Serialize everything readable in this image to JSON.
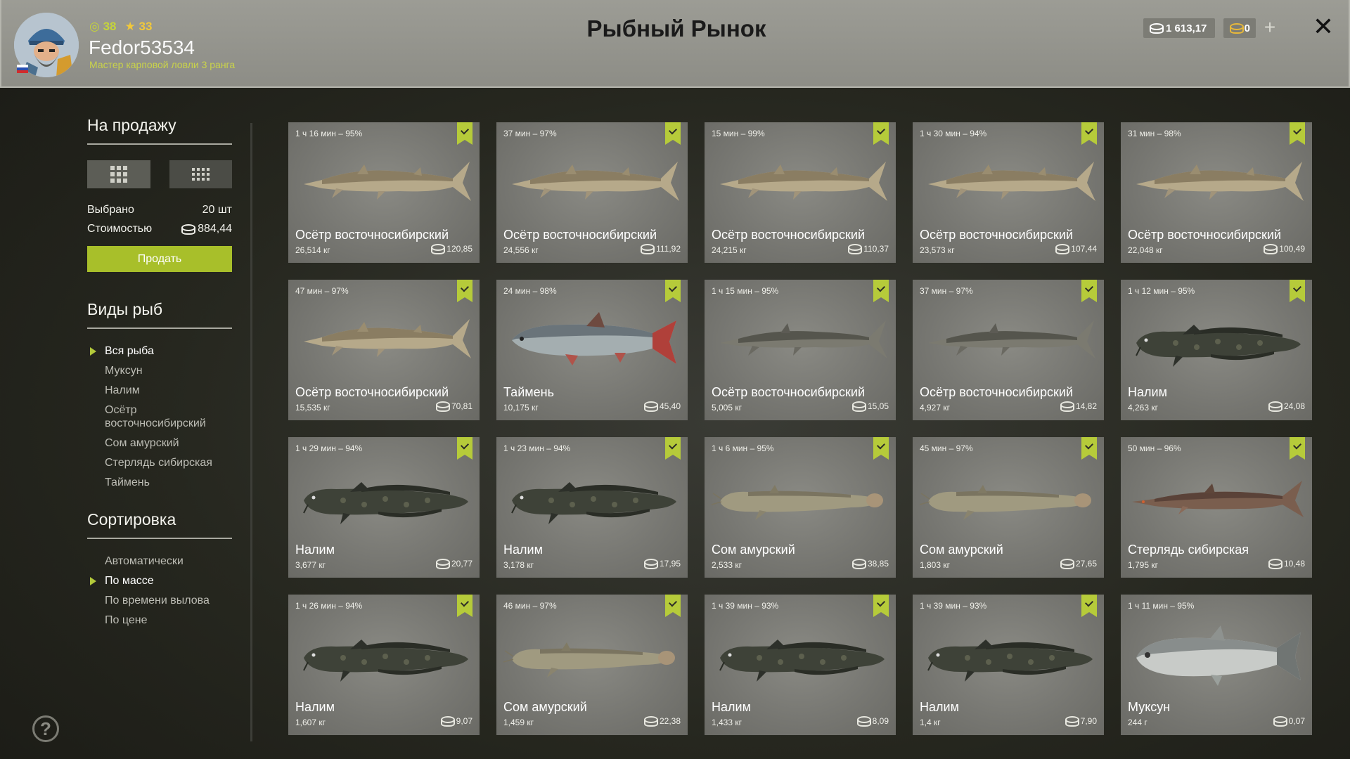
{
  "header": {
    "title": "Рыбный Рынок",
    "level": "38",
    "rank": "33",
    "username": "Fedor53534",
    "subtitle": "Мастер карповой ловли 3 ранга",
    "silver": "1 613,17",
    "gold": "0",
    "plus": "+",
    "close": "✕"
  },
  "sidebar": {
    "for_sale_title": "На продажу",
    "selected_label": "Выбрано",
    "selected_value": "20 шт",
    "cost_label": "Стоимостью",
    "cost_value": "884,44",
    "sell_button": "Продать",
    "species_title": "Виды рыб",
    "species": [
      {
        "label": "Вся рыба",
        "active": true
      },
      {
        "label": "Муксун",
        "active": false
      },
      {
        "label": "Налим",
        "active": false
      },
      {
        "label": "Осётр восточносибирский",
        "active": false
      },
      {
        "label": "Сом амурский",
        "active": false
      },
      {
        "label": "Стерлядь сибирская",
        "active": false
      },
      {
        "label": "Таймень",
        "active": false
      }
    ],
    "sort_title": "Сортировка",
    "sort": [
      {
        "label": "Автоматически",
        "active": false
      },
      {
        "label": "По массе",
        "active": true
      },
      {
        "label": "По времени вылова",
        "active": false
      },
      {
        "label": "По цене",
        "active": false
      }
    ],
    "help": "?"
  },
  "fish": [
    {
      "time": "1 ч 16 мин – 95%",
      "name": "Осётр восточносибирский",
      "weight": "26,514 кг",
      "price": "120,85",
      "type": "sturgeon",
      "selected": true
    },
    {
      "time": "37 мин – 97%",
      "name": "Осётр восточносибирский",
      "weight": "24,556 кг",
      "price": "111,92",
      "type": "sturgeon",
      "selected": true
    },
    {
      "time": "15 мин – 99%",
      "name": "Осётр восточносибирский",
      "weight": "24,215 кг",
      "price": "110,37",
      "type": "sturgeon",
      "selected": true
    },
    {
      "time": "1 ч 30 мин – 94%",
      "name": "Осётр восточносибирский",
      "weight": "23,573 кг",
      "price": "107,44",
      "type": "sturgeon",
      "selected": true
    },
    {
      "time": "31 мин – 98%",
      "name": "Осётр восточносибирский",
      "weight": "22,048 кг",
      "price": "100,49",
      "type": "sturgeon",
      "selected": true
    },
    {
      "time": "47 мин – 97%",
      "name": "Осётр восточносибирский",
      "weight": "15,535 кг",
      "price": "70,81",
      "type": "sturgeon",
      "selected": true
    },
    {
      "time": "24 мин – 98%",
      "name": "Таймень",
      "weight": "10,175 кг",
      "price": "45,40",
      "type": "taimen",
      "selected": true
    },
    {
      "time": "1 ч 15 мин – 95%",
      "name": "Осётр восточносибирский",
      "weight": "5,005 кг",
      "price": "15,05",
      "type": "sturgeon-dark",
      "selected": true
    },
    {
      "time": "37 мин – 97%",
      "name": "Осётр восточносибирский",
      "weight": "4,927 кг",
      "price": "14,82",
      "type": "sturgeon-dark",
      "selected": true
    },
    {
      "time": "1 ч 12 мин – 95%",
      "name": "Налим",
      "weight": "4,263 кг",
      "price": "24,08",
      "type": "burbot",
      "selected": true
    },
    {
      "time": "1 ч 29 мин – 94%",
      "name": "Налим",
      "weight": "3,677 кг",
      "price": "20,77",
      "type": "burbot",
      "selected": true
    },
    {
      "time": "1 ч 23 мин – 94%",
      "name": "Налим",
      "weight": "3,178 кг",
      "price": "17,95",
      "type": "burbot",
      "selected": true
    },
    {
      "time": "1 ч 6 мин – 95%",
      "name": "Сом амурский",
      "weight": "2,533 кг",
      "price": "38,85",
      "type": "catfish",
      "selected": true
    },
    {
      "time": "45 мин – 97%",
      "name": "Сом амурский",
      "weight": "1,803 кг",
      "price": "27,65",
      "type": "catfish",
      "selected": true
    },
    {
      "time": "50 мин – 96%",
      "name": "Стерлядь сибирская",
      "weight": "1,795 кг",
      "price": "10,48",
      "type": "sterlet",
      "selected": true
    },
    {
      "time": "1 ч 26 мин – 94%",
      "name": "Налим",
      "weight": "1,607 кг",
      "price": "9,07",
      "type": "burbot",
      "selected": true
    },
    {
      "time": "46 мин – 97%",
      "name": "Сом амурский",
      "weight": "1,459 кг",
      "price": "22,38",
      "type": "catfish",
      "selected": true
    },
    {
      "time": "1 ч 39 мин – 93%",
      "name": "Налим",
      "weight": "1,433 кг",
      "price": "8,09",
      "type": "burbot",
      "selected": true
    },
    {
      "time": "1 ч 39 мин – 93%",
      "name": "Налим",
      "weight": "1,4 кг",
      "price": "7,90",
      "type": "burbot",
      "selected": true
    },
    {
      "time": "1 ч 11 мин – 95%",
      "name": "Муксун",
      "weight": "244 г",
      "price": "0,07",
      "type": "muksun",
      "selected": false
    }
  ],
  "colors": {
    "accent": "#b6cb3a",
    "sell_button": "#a8bf2a",
    "header_bg": "#959590"
  }
}
